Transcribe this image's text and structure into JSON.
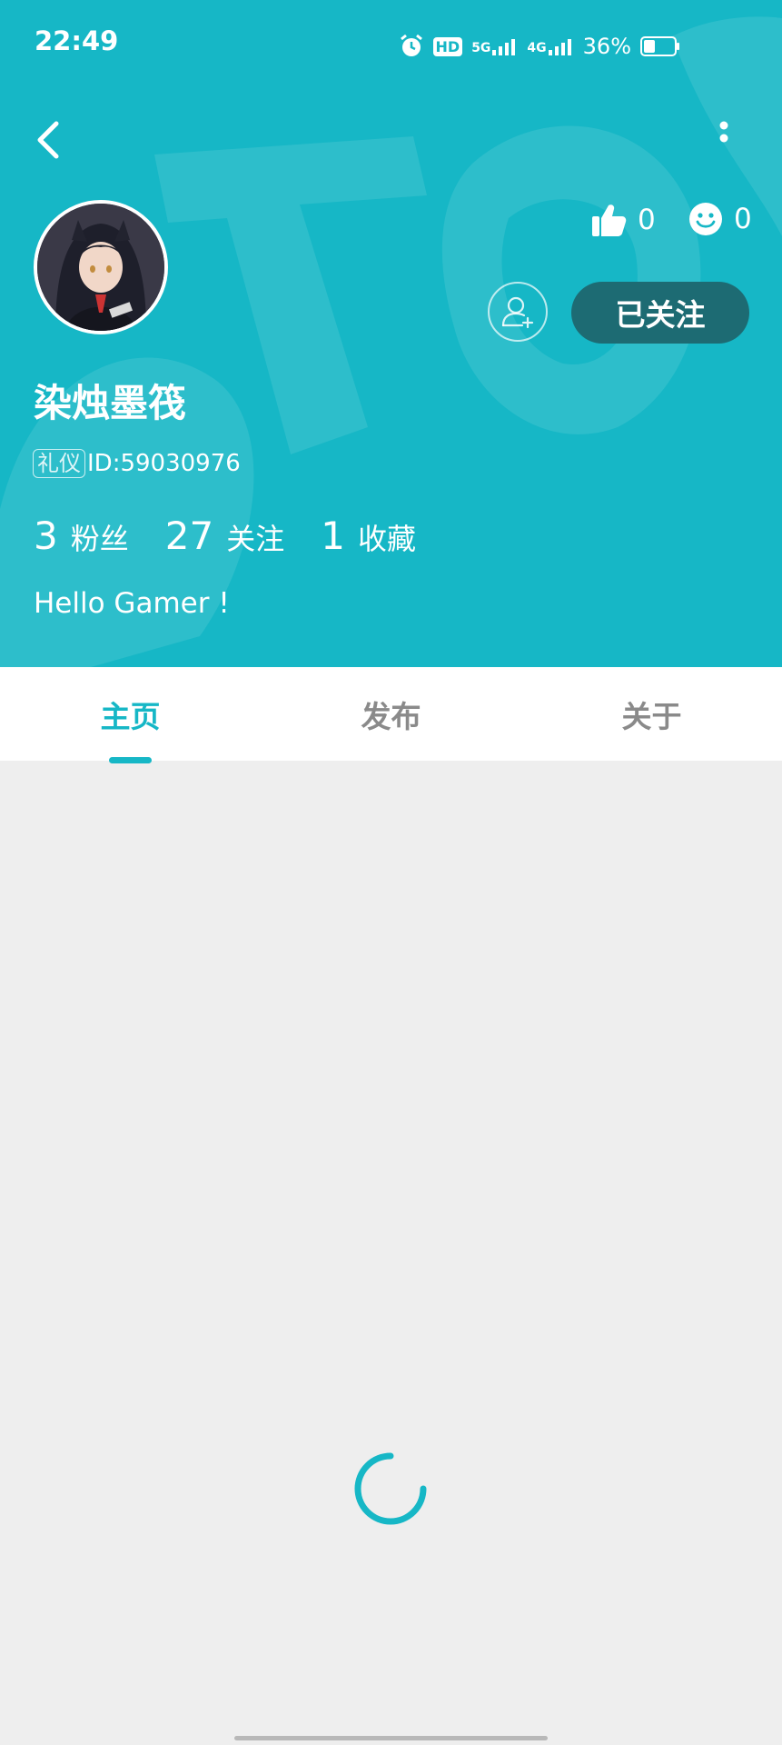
{
  "status_bar": {
    "time": "22:49",
    "network_1": "5G",
    "network_2": "4G",
    "hd_label": "HD",
    "battery_percent": "36%",
    "battery_level": 0.36
  },
  "profile": {
    "likes_count": "0",
    "emoji_count": "0",
    "follow_status": "已关注",
    "username": "染烛墨筏",
    "role_tag": "礼仪",
    "id_text": "ID:59030976",
    "stats": [
      {
        "value": "3",
        "label": "粉丝"
      },
      {
        "value": "27",
        "label": "关注"
      },
      {
        "value": "1",
        "label": "收藏"
      }
    ],
    "bio": "Hello Gamer !"
  },
  "tabs": [
    {
      "label": "主页",
      "active": true
    },
    {
      "label": "发布",
      "active": false
    },
    {
      "label": "关于",
      "active": false
    }
  ],
  "colors": {
    "accent": "#16b7c6",
    "follow_button": "#1d6b73",
    "content_bg": "#eeeeee"
  }
}
